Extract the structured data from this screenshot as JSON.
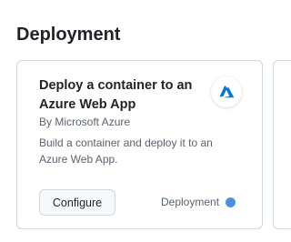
{
  "section": {
    "title": "Deployment"
  },
  "card": {
    "title": "Deploy a container to an Azure Web App",
    "author": "By Microsoft Azure",
    "description": "Build a container and deploy it to an Azure Web App.",
    "logo_icon": "azure-logo-icon",
    "configure_label": "Configure",
    "category_label": "Deployment",
    "category_color": "#4a90e2"
  },
  "colors": {
    "azure_blue": "#0078d4",
    "border": "#d0d7de",
    "muted_text": "#59636e"
  }
}
